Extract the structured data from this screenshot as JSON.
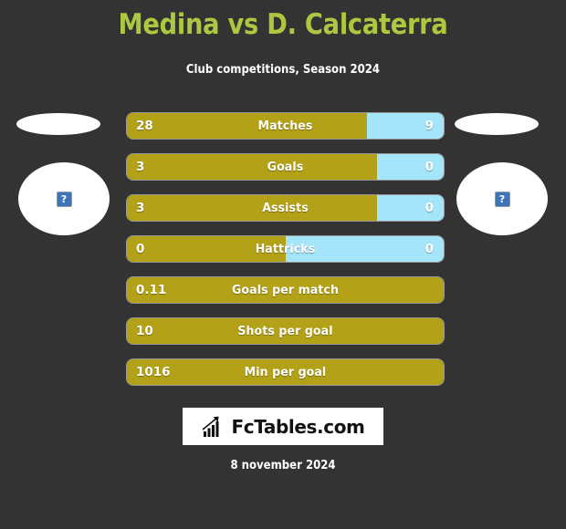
{
  "header": {
    "title": "Medina vs D. Calcaterra",
    "subtitle": "Club competitions, Season 2024"
  },
  "players": {
    "home": {
      "flag_placeholder": "",
      "photo_placeholder": "?"
    },
    "away": {
      "flag_placeholder": "",
      "photo_placeholder": "?"
    }
  },
  "footer": {
    "logo_text": "FcTables.com",
    "logo_icon": "bar-chart-growth-icon",
    "date": "8 november 2024"
  },
  "colors": {
    "background": "#333333",
    "title": "#adc840",
    "home_bar": "#b3a218",
    "away_bar": "#a5e5fa",
    "text": "#ffffff"
  },
  "chart_data": {
    "type": "bar",
    "title": "Medina vs D. Calcaterra",
    "subtitle": "Club competitions, Season 2024",
    "orientation": "horizontal-diverging",
    "legend": [
      "Medina",
      "D. Calcaterra"
    ],
    "series": [
      {
        "name": "Medina",
        "color": "#b3a218",
        "values": [
          28,
          3,
          3,
          0,
          0.11,
          10,
          1016
        ]
      },
      {
        "name": "D. Calcaterra",
        "color": "#a5e5fa",
        "values": [
          9,
          0,
          0,
          0,
          null,
          null,
          null
        ]
      }
    ],
    "categories": [
      "Matches",
      "Goals",
      "Assists",
      "Hattricks",
      "Goals per match",
      "Shots per goal",
      "Min per goal"
    ],
    "rows": [
      {
        "label": "Matches",
        "home": "28",
        "away": "9",
        "home_pct": 75.7,
        "split": true
      },
      {
        "label": "Goals",
        "home": "3",
        "away": "0",
        "home_pct": 79.0,
        "split": true
      },
      {
        "label": "Assists",
        "home": "3",
        "away": "0",
        "home_pct": 79.0,
        "split": true
      },
      {
        "label": "Hattricks",
        "home": "0",
        "away": "0",
        "home_pct": 50.0,
        "split": true
      },
      {
        "label": "Goals per match",
        "home": "0.11",
        "away": "",
        "home_pct": 100,
        "split": false
      },
      {
        "label": "Shots per goal",
        "home": "10",
        "away": "",
        "home_pct": 100,
        "split": false
      },
      {
        "label": "Min per goal",
        "home": "1016",
        "away": "",
        "home_pct": 100,
        "split": false
      }
    ]
  }
}
